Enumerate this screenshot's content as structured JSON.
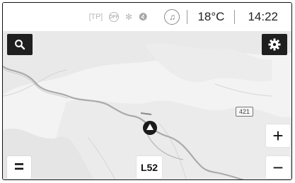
{
  "status_bar": {
    "tp_label": "[TP]",
    "off_label": "OFF",
    "bluetooth_glyph": "✻",
    "mute_glyph": "🔇",
    "music_glyph": "♫",
    "temperature": "18°C",
    "time": "14:22"
  },
  "map": {
    "road_sign": "421",
    "road_label": "L52"
  },
  "controls": {
    "search_icon": "search-icon",
    "settings_icon": "gear-icon",
    "menu_label": "=",
    "zoom_in_label": "+",
    "zoom_out_label": "−"
  },
  "colors": {
    "button_dark": "#1f1f1f",
    "route": "#9a9a9a",
    "position_marker": "#1a1a1a"
  }
}
